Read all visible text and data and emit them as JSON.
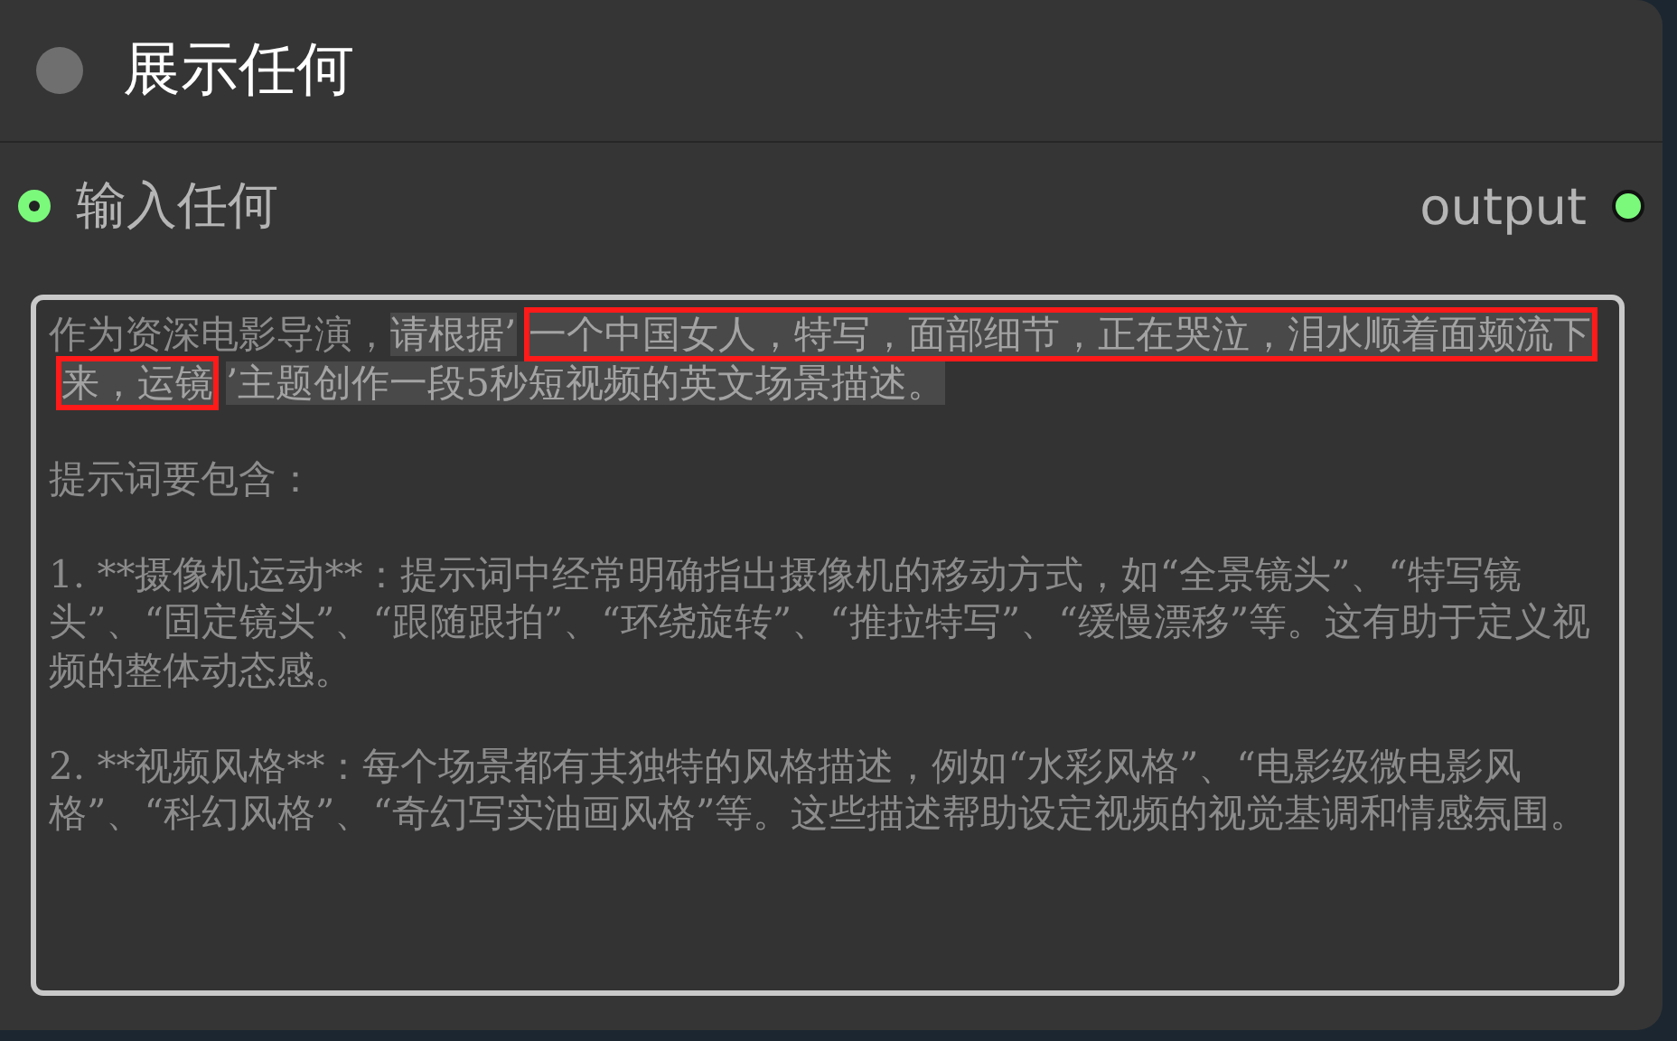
{
  "node": {
    "title": "展示任何"
  },
  "input": {
    "label": "输入任何",
    "connected": true
  },
  "output": {
    "label": "output",
    "connected": true
  },
  "text": {
    "paragraphs": [
      [
        {
          "text": "作为资深电影导演，",
          "selected": false,
          "boxed": false
        },
        {
          "text": "请根据’",
          "selected": true,
          "boxed": false
        },
        {
          "text": "一个中国女人，特写，面部细节，正在哭泣，泪水顺着面颊流下来，运镜",
          "selected": true,
          "boxed": true
        },
        {
          "text": "’主题创作一段5秒短视频的英文场景描述。",
          "selected": true,
          "boxed": false
        }
      ],
      [
        {
          "text": "提示词要包含：",
          "selected": false
        }
      ],
      [
        {
          "text": "1. **摄像机运动**：提示词中经常明确指出摄像机的移动方式，如“全景镜头”、“特写镜头”、“固定镜头”、“跟随跟拍”、“环绕旋转”、“推拉特写”、“缓慢漂移”等。这有助于定义视频的整体动态感。",
          "selected": false
        }
      ],
      [
        {
          "text": "2. **视频风格**：每个场景都有其独特的风格描述，例如“水彩风格”、“电影级微电影风格”、“科幻风格”、“奇幻写实油画风格”等。这些描述帮助设定视频的视觉基调和情感氛围。",
          "selected": false
        }
      ]
    ]
  }
}
